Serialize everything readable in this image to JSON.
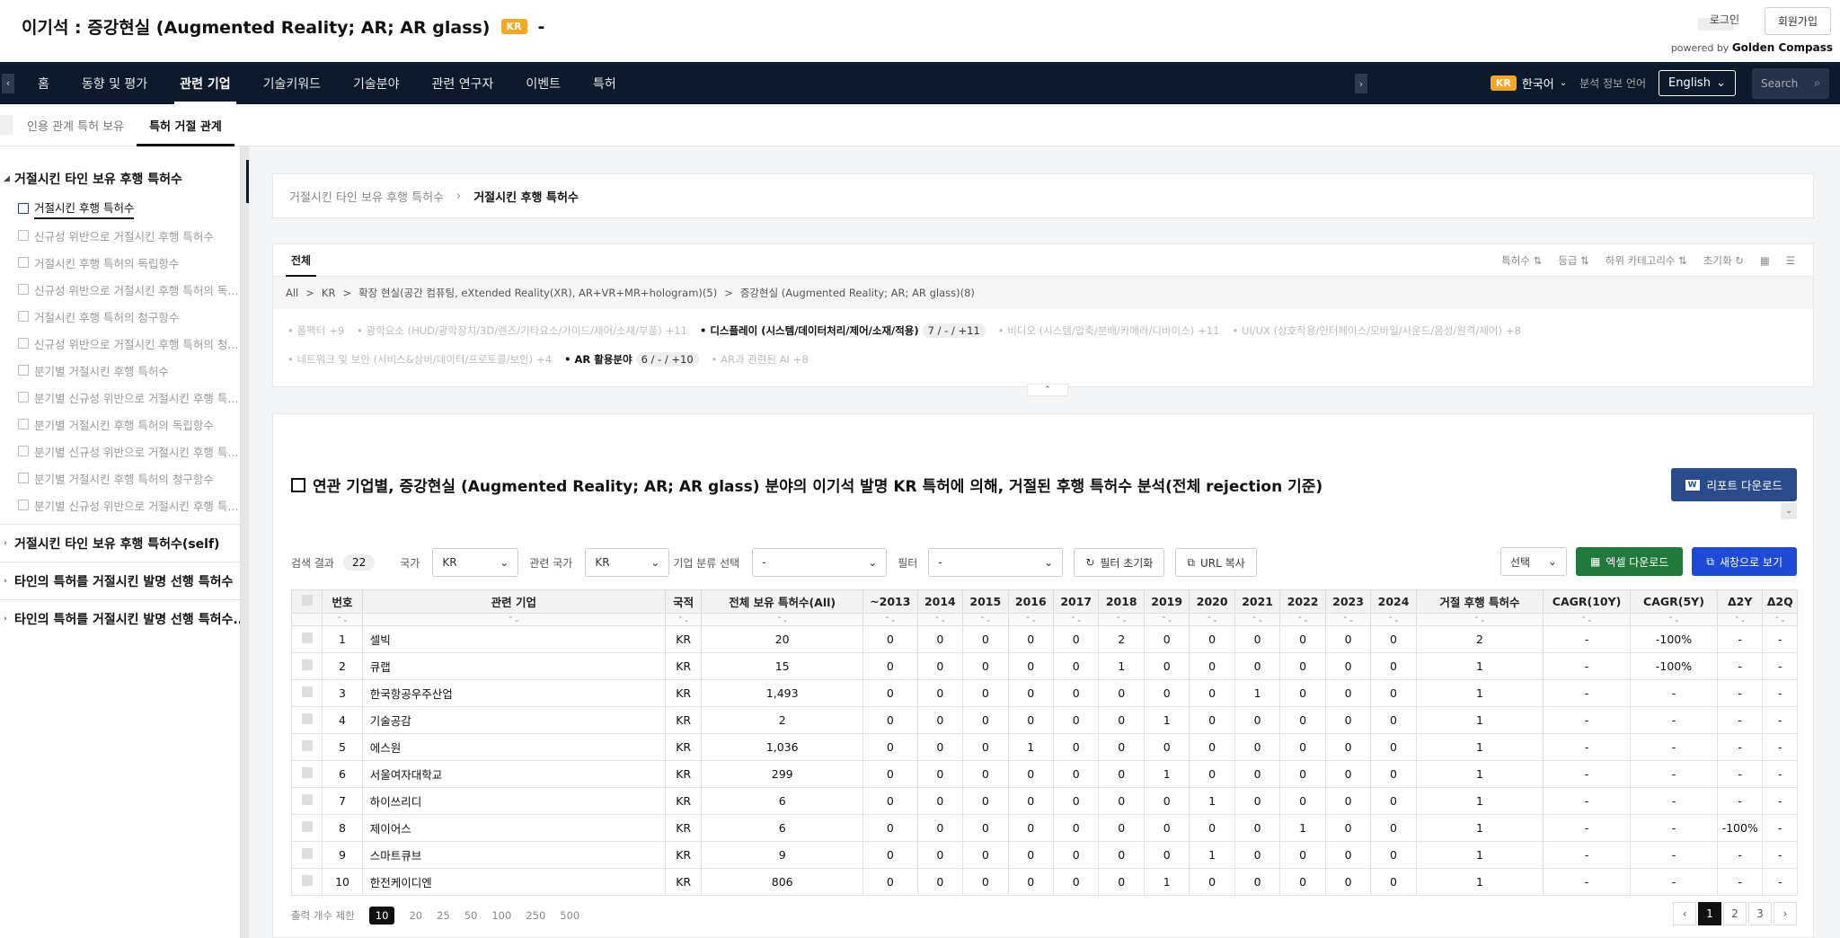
{
  "header": {
    "title": "이기석 :  증강현실 (Augmented Reality; AR; AR glass)",
    "badge": "KR",
    "dash": "-",
    "login": "로그인",
    "signup": "회원가입",
    "powered_by": "powered by",
    "brand": "Golden Compass"
  },
  "nav": {
    "items": [
      "홈",
      "동향 및 평가",
      "관련 기업",
      "기술키워드",
      "기술분야",
      "관련 연구자",
      "이벤트",
      "특허"
    ],
    "active_index": 2,
    "lang_badge": "KR",
    "lang_label": "한국어",
    "analysis_lang": "분석 정보 언어",
    "lang_select": "English",
    "search_placeholder": "Search"
  },
  "subtabs": {
    "items": [
      "인용 관계 특허 보유",
      "특허 거절 관계"
    ],
    "active_index": 1
  },
  "sidebar": {
    "head": "거절시킨 타인 보유 후행 특허수",
    "items": [
      "거절시킨 후행 특허수",
      "신규성 위반으로 거절시킨 후행 특허수",
      "거절시킨 후행 특허의 독립항수",
      "신규성 위반으로 거절시킨 후행 특허의 독...",
      "거절시킨 후행 특허의 청구항수",
      "신규성 위반으로 거절시킨 후행 특허의 청...",
      "분기별 거절시킨 후행 특허수",
      "분기별 신규성 위반으로 거절시킨 후행 특...",
      "분기별 거절시킨 후행 특허의 독립항수",
      "분기별 신규성 위반으로 거절시킨 후행 특...",
      "분기별 거절시킨 후행 특허의 청구항수",
      "분기별 신규성 위반으로 거절시킨 후행 특..."
    ],
    "sections": [
      "거절시킨 타인 보유 후행 특허수(self)",
      "타인의 특허를 거절시킨 발명 선행 특허수",
      "타인의 특허를 거절시킨 발명 선행 특허수..."
    ],
    "collapse_icon": "«"
  },
  "breadcrumb": {
    "parent": "거절시킨 타인 보유 후행 특허수",
    "sep": "›",
    "current": "거절시킨 후행 특허수"
  },
  "filter": {
    "tab": "전체",
    "sorts": [
      "특허수 ⇅",
      "등급 ⇅",
      "하위 카테고리수 ⇅",
      "초기화 ↻"
    ],
    "path": [
      "All",
      ">",
      "KR",
      ">",
      "확장 현실(공간 컴퓨팅, eXtended Reality(XR), AR+VR+MR+hologram)(5)",
      ">",
      "증강현실 (Augmented Reality; AR; AR glass)(8)"
    ],
    "categories_row1": [
      {
        "label": "폼팩터",
        "count": "+9",
        "on": false
      },
      {
        "label": "광학요소 (HUD/광학장치/3D/렌즈/기타요소/가이드/제어/소재/부품)",
        "count": "+11",
        "on": false
      },
      {
        "label": "디스플레이 (시스템/데이터처리/제어/소재/적용)",
        "count": "7 / - / +11",
        "on": true
      },
      {
        "label": "비디오 (시스템/압축/분배/카메라/디바이스)",
        "count": "+11",
        "on": false
      },
      {
        "label": "UI/UX (상호작용/인터페이스/모바일/사운드/음성/원격/제어)",
        "count": "+8",
        "on": false
      }
    ],
    "categories_row2": [
      {
        "label": "네트워크 및 보안 (서비스&상비/데이터/프로토콜/보안)",
        "count": "+4",
        "on": false
      },
      {
        "label": "AR 활용분야",
        "count": "6 / - / +10",
        "on": true
      },
      {
        "label": "AR과 관련된 AI",
        "count": "+8",
        "on": false
      }
    ],
    "toggle": "⌃"
  },
  "table_section": {
    "title": "연관 기업별, 증강현실 (Augmented Reality; AR; AR glass) 분야의 이기석 발명 KR 특허에 의해, 거절된 후행 특허수 분석(전체 rejection 기준)",
    "report_button": "리포트 다운로드",
    "report_icon": "W",
    "result_label": "검색 결과",
    "result_count": "22",
    "country_label": "국가",
    "country_value": "KR",
    "related_country_label": "관련 국가",
    "related_country_value": "KR",
    "company_class_label": "기업 분류 선택",
    "company_class_value": "-",
    "filter_label": "필터",
    "filter_value": "-",
    "filter_reset": "필터 초기화",
    "url_copy": "URL 복사",
    "select_label": "선택",
    "excel_button": "엑셀 다운로드",
    "new_window_button": "새창으로 보기",
    "headers": [
      "번호",
      "관련 기업",
      "국적",
      "전체 보유 특허수(All)",
      "~2013",
      "2014",
      "2015",
      "2016",
      "2017",
      "2018",
      "2019",
      "2020",
      "2021",
      "2022",
      "2023",
      "2024",
      "거절 후행 특허수",
      "CAGR(10Y)",
      "CAGR(5Y)",
      "Δ2Y",
      "Δ2Q"
    ],
    "sort_glyph": "⌃⌄",
    "rows": [
      [
        "1",
        "셀빅",
        "KR",
        "20",
        "0",
        "0",
        "0",
        "0",
        "0",
        "2",
        "0",
        "0",
        "0",
        "0",
        "0",
        "0",
        "2",
        "-",
        "-100%",
        "-",
        "-"
      ],
      [
        "2",
        "큐랩",
        "KR",
        "15",
        "0",
        "0",
        "0",
        "0",
        "0",
        "1",
        "0",
        "0",
        "0",
        "0",
        "0",
        "0",
        "1",
        "-",
        "-100%",
        "-",
        "-"
      ],
      [
        "3",
        "한국항공우주산업",
        "KR",
        "1,493",
        "0",
        "0",
        "0",
        "0",
        "0",
        "0",
        "0",
        "0",
        "1",
        "0",
        "0",
        "0",
        "1",
        "-",
        "-",
        "-",
        "-"
      ],
      [
        "4",
        "기술공감",
        "KR",
        "2",
        "0",
        "0",
        "0",
        "0",
        "0",
        "0",
        "1",
        "0",
        "0",
        "0",
        "0",
        "0",
        "1",
        "-",
        "-",
        "-",
        "-"
      ],
      [
        "5",
        "에스원",
        "KR",
        "1,036",
        "0",
        "0",
        "0",
        "1",
        "0",
        "0",
        "0",
        "0",
        "0",
        "0",
        "0",
        "0",
        "1",
        "-",
        "-",
        "-",
        "-"
      ],
      [
        "6",
        "서울여자대학교",
        "KR",
        "299",
        "0",
        "0",
        "0",
        "0",
        "0",
        "0",
        "1",
        "0",
        "0",
        "0",
        "0",
        "0",
        "1",
        "-",
        "-",
        "-",
        "-"
      ],
      [
        "7",
        "하이쓰리디",
        "KR",
        "6",
        "0",
        "0",
        "0",
        "0",
        "0",
        "0",
        "0",
        "1",
        "0",
        "0",
        "0",
        "0",
        "1",
        "-",
        "-",
        "-",
        "-"
      ],
      [
        "8",
        "제이어스",
        "KR",
        "6",
        "0",
        "0",
        "0",
        "0",
        "0",
        "0",
        "0",
        "0",
        "0",
        "1",
        "0",
        "0",
        "1",
        "-",
        "-",
        "-100%",
        "-"
      ],
      [
        "9",
        "스마트큐브",
        "KR",
        "9",
        "0",
        "0",
        "0",
        "0",
        "0",
        "0",
        "0",
        "1",
        "0",
        "0",
        "0",
        "0",
        "1",
        "-",
        "-",
        "-",
        "-"
      ],
      [
        "10",
        "한전케이디엔",
        "KR",
        "806",
        "0",
        "0",
        "0",
        "0",
        "0",
        "0",
        "1",
        "0",
        "0",
        "0",
        "0",
        "0",
        "1",
        "-",
        "-",
        "-",
        "-"
      ]
    ],
    "page_size_label": "출력 개수 제한",
    "page_sizes": [
      "10",
      "20",
      "25",
      "50",
      "100",
      "250",
      "500"
    ],
    "page_size_active": 0,
    "pages": [
      "‹",
      "1",
      "2",
      "3",
      "›"
    ],
    "page_active": 1
  },
  "colors": {
    "navbar": "#0d1a2b",
    "badge": "#f5a623",
    "report": "#2b4c8c",
    "excel": "#1f7a3c",
    "newwin": "#1f4ad8"
  }
}
